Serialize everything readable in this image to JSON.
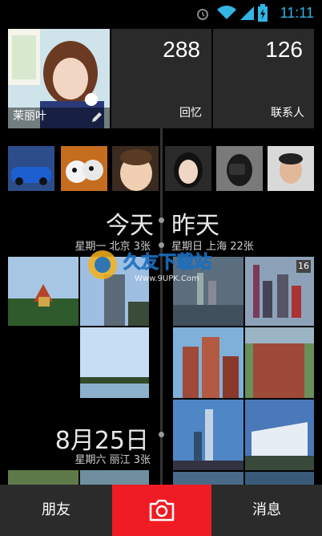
{
  "status_bar": {
    "time": "11:11"
  },
  "profile": {
    "name": "茉丽叶"
  },
  "stats": [
    {
      "value": "288",
      "label": "回忆"
    },
    {
      "value": "126",
      "label": "联系人"
    }
  ],
  "timeline": {
    "today": {
      "day": "今天",
      "meta": "星期一 北京 3张"
    },
    "yesterday": {
      "day": "昨天",
      "meta": "星期日 上海 22张"
    },
    "older": {
      "day": "8月25日",
      "meta": "星期六 丽江 3张"
    }
  },
  "badge_count": "16",
  "watermark": {
    "brand": "久友下载站",
    "url": "Www.9UPK.Com"
  },
  "bottom_nav": {
    "friends": "朋友",
    "messages": "消息"
  },
  "colors": {
    "accent_red": "#ef1c24",
    "clock_blue": "#33b5e5"
  }
}
